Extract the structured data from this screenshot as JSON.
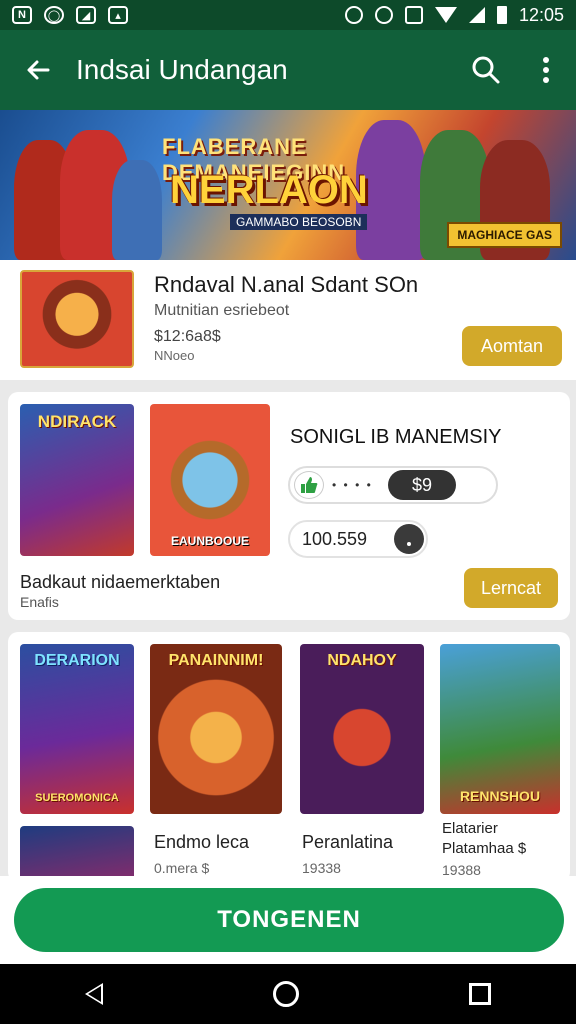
{
  "status_bar": {
    "left_icons": [
      "notification-icon",
      "whatsapp-icon",
      "notification-icon",
      "notification-icon"
    ],
    "time": "12:05"
  },
  "app_bar": {
    "title": "Indsai Undangan",
    "icons": [
      "back-arrow-icon",
      "search-icon",
      "more-vert-icon"
    ]
  },
  "banner": {
    "line1": "FLABERANE",
    "line2": "DEMANEIEGINN",
    "headline": "NERLAON",
    "sub": "GAMMABO BEOSOBN",
    "badge": "MAGHIACE GAS"
  },
  "featured": {
    "title": "Rndaval N.anal Sdant SOn",
    "subtitle": "Mutnitian esriebeot",
    "price": "$12:6a8$",
    "meta": "NNoeo",
    "button": "Aomtan"
  },
  "bundle": {
    "poster1_label": "NDIRACK",
    "poster2_label": "EAUNBOOUE",
    "title": "SONIGL IB MANEMSIY",
    "toggle_value": "$9",
    "toggle_dots": "• • • •",
    "stepper_value": "100.559",
    "description": "Badkaut nidaemerktaben",
    "description_sub": "Enafis",
    "button": "Lerncat"
  },
  "grid": {
    "items": [
      {
        "poster_label": "DERARION",
        "poster_sub": "SUEROMONICA"
      },
      {
        "poster_label": "PANAINNIM!",
        "name": "Endmo leca",
        "price": "0.mera $"
      },
      {
        "poster_label": "NDAHOY",
        "name": "Peranlatina",
        "price": "19338"
      },
      {
        "poster_label": "RENNSHOU",
        "name": "Elatarier",
        "subname": "Platamhaa $",
        "price": "19388"
      }
    ]
  },
  "cta_button": "TONGENEN",
  "nav_bar": {
    "icons": [
      "nav-back-icon",
      "nav-home-icon",
      "nav-recents-icon"
    ]
  },
  "colors": {
    "app_bar": "#11603a",
    "status_bar": "#0d4a2a",
    "accent_yellow": "#d2a92a",
    "cta_green": "#139a53"
  }
}
